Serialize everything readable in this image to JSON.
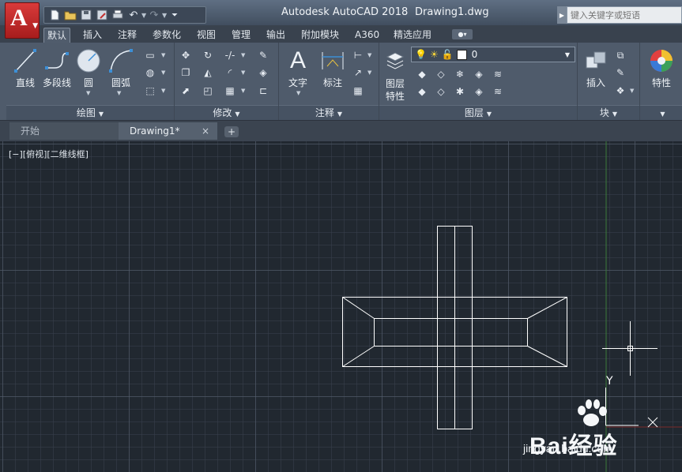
{
  "window": {
    "app_title": "Autodesk AutoCAD 2018",
    "doc_title": "Drawing1.dwg",
    "search_placeholder": "键入关键字或短语"
  },
  "ribbon_tabs": [
    "默认",
    "插入",
    "注释",
    "参数化",
    "视图",
    "管理",
    "输出",
    "附加模块",
    "A360",
    "精选应用"
  ],
  "panels": {
    "draw": {
      "label": "绘图",
      "line": "直线",
      "polyline": "多段线",
      "circle": "圆",
      "arc": "圆弧"
    },
    "modify": {
      "label": "修改"
    },
    "annotation": {
      "label": "注释",
      "text": "文字",
      "dimension": "标注"
    },
    "layers": {
      "label": "图层",
      "layer_props_1": "图层",
      "layer_props_2": "特性",
      "current_layer": "0"
    },
    "block": {
      "label": "块",
      "insert": "插入"
    },
    "properties": {
      "label": "特性"
    }
  },
  "file_tabs": {
    "start": "开始",
    "drawing": "Drawing1*",
    "close": "×",
    "add": "+"
  },
  "viewport": {
    "label": "[−][俯视][二维线框]"
  },
  "ucs": {
    "y_label": "Y",
    "x_label": "X"
  },
  "watermark": {
    "text": "Bai经验",
    "url": "jingyan.baidu.com"
  },
  "colors": {
    "accent_red": "#c62828",
    "canvas": "#212830",
    "ribbon": "#4f5b6b",
    "titlebar": "#4a5768"
  }
}
